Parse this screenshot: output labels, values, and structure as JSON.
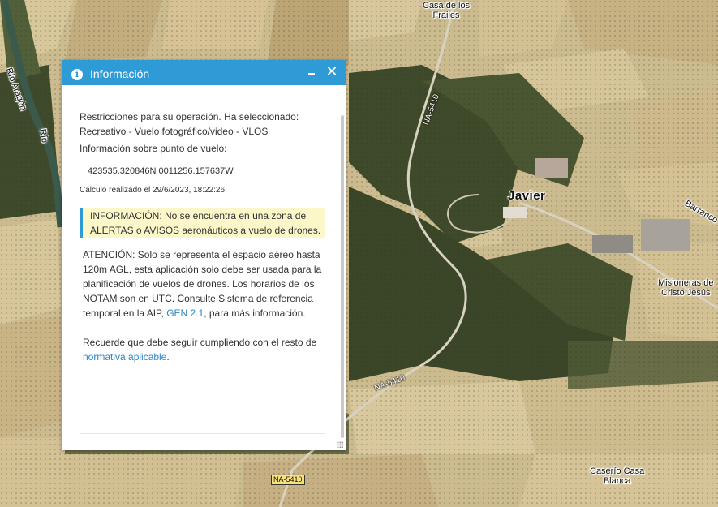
{
  "map": {
    "labels": {
      "casa_frailes": "Casa de los\nFrailes",
      "javier": "Javier",
      "misioneras": "Misioneras de\nCristo Jesús",
      "caserio": "Caserío Casa\nBlanca",
      "rio_aragon": "Río Aragón",
      "rio": "Río",
      "barranco": "Barranco"
    },
    "roads": {
      "na5410_a": "NA-5410",
      "na5410_b": "NA-5410",
      "na5410_shield": "NA-5410"
    }
  },
  "panel": {
    "title": "Información",
    "info_icon": "info-circle-icon",
    "minimize_icon": "minimize-icon",
    "close_icon": "close-icon",
    "restricciones": "Restricciones para su operación. Ha seleccionado: Recreativo - Vuelo fotográfico/video - VLOS",
    "punto_label": "Información sobre punto de vuelo:",
    "coordinates": "423535.320846N 0011256.157637W",
    "calculo": "Cálculo realizado el 29/6/2023, 18:22:26",
    "alert": "INFORMACIÓN: No se encuentra en una zona de ALERTAS o AVISOS aeronáuticos a vuelo de drones.",
    "atencion_text": "ATENCIÓN: Solo se representa el espacio aéreo hasta 120m AGL, esta aplicación solo debe ser usada para la planificación de vuelos de drones. Los horarios de los NOTAM son en UTC. Consulte Sistema de referencia temporal en la AIP, ",
    "atencion_link": "GEN 2.1",
    "atencion_tail": ", para más información.",
    "recuerde_text": "Recuerde que debe seguir cumpliendo con el resto de ",
    "recuerde_link": "normativa aplicable",
    "recuerde_tail": "."
  },
  "colors": {
    "header": "#2e9bd6",
    "alert_bg": "#fbf7c9",
    "link": "#2e86c4"
  }
}
